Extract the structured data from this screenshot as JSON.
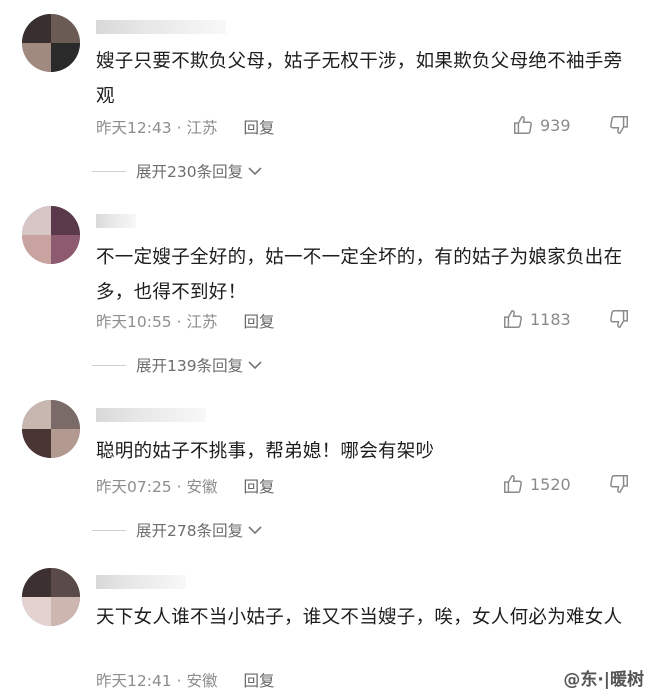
{
  "comments": [
    {
      "text": "嫂子只要不欺负父母，姑子无权干涉，如果欺负父母绝不袖手旁观",
      "time": "昨天12:43",
      "location": "江苏",
      "reply_label": "回复",
      "likes": "939",
      "expand_label": "展开230条回复"
    },
    {
      "text": "不一定嫂子全好的，姑一不一定全坏的，有的姑子为娘家负出在多，也得不到好！",
      "time": "昨天10:55",
      "location": "江苏",
      "reply_label": "回复",
      "likes": "1183",
      "expand_label": "展开139条回复"
    },
    {
      "text": "聪明的姑子不挑事，帮弟媳！哪会有架吵",
      "time": "昨天07:25",
      "location": "安徽",
      "reply_label": "回复",
      "likes": "1520",
      "expand_label": "展开278条回复"
    },
    {
      "text": "天下女人谁不当小姑子，谁又不当嫂子，唉，女人何必为难女人",
      "time": "昨天12:41",
      "location": "安徽",
      "reply_label": "回复"
    }
  ],
  "separator": " · ",
  "watermark": "@东·|暖树",
  "colors": {
    "text": "#1d1d1d",
    "meta": "#8e8e8e",
    "icon": "#8a8a8a"
  },
  "icons": {
    "like": "thumbs-up-icon",
    "dislike": "thumbs-down-icon",
    "expand": "chevron-down-icon"
  }
}
